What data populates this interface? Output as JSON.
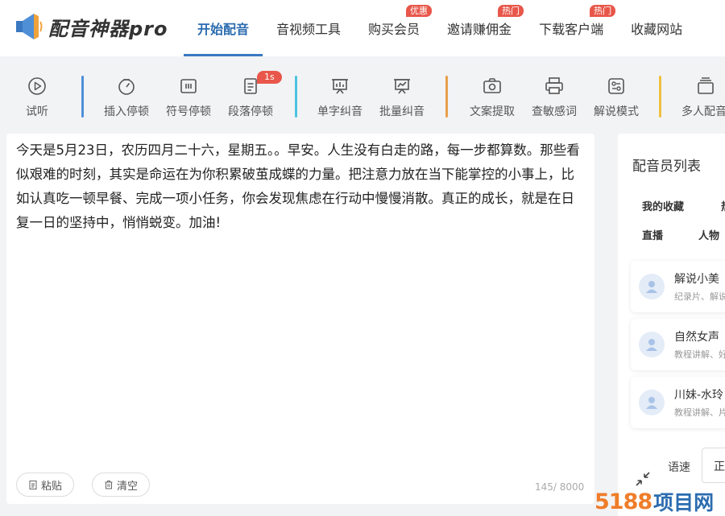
{
  "app": {
    "logo_text": "配音神器pro"
  },
  "nav": [
    {
      "label": "开始配音",
      "active": true
    },
    {
      "label": "音视频工具"
    },
    {
      "label": "购买会员",
      "badge": "优惠"
    },
    {
      "label": "邀请赚佣金",
      "badge": "热门"
    },
    {
      "label": "下载客户端",
      "badge": "热门"
    },
    {
      "label": "收藏网站"
    }
  ],
  "toolbar": {
    "items": [
      {
        "label": "试听",
        "icon": "play-circle-icon"
      },
      {
        "label": "插入停顿",
        "icon": "stopwatch-icon"
      },
      {
        "label": "符号停顿",
        "icon": "symbol-pause-icon"
      },
      {
        "label": "段落停顿",
        "icon": "document-icon",
        "badge": "1s"
      },
      {
        "label": "单字纠音",
        "icon": "presentation-icon"
      },
      {
        "label": "批量纠音",
        "icon": "chart-board-icon"
      },
      {
        "label": "文案提取",
        "icon": "camera-icon"
      },
      {
        "label": "查敏感词",
        "icon": "printer-icon"
      },
      {
        "label": "解说模式",
        "icon": "sliders-icon"
      },
      {
        "label": "多人配音",
        "icon": "layers-icon"
      }
    ]
  },
  "editor": {
    "text": "今天是5月23日，农历四月二十六，星期五。。早安。人生没有白走的路，每一步都算数。那些看似艰难的时刻，其实是命运在为你积累破茧成蝶的力量。把注意力放在当下能掌控的小事上，比如认真吃一顿早餐、完成一项小任务，你会发现焦虑在行动中慢慢消散。真正的成长，就是在日复一日的坚持中，悄悄蜕变。加油!",
    "paste_label": "粘贴",
    "clear_label": "清空",
    "counter": "145/ 8000"
  },
  "panel": {
    "title": "配音员列表",
    "tabs": [
      "我的收藏",
      "热",
      "直播",
      "人物"
    ],
    "voices": [
      {
        "name": "解说小美",
        "desc": "纪录片、解说"
      },
      {
        "name": "自然女声",
        "desc": "教程讲解、好"
      },
      {
        "name": "川妹-水玲",
        "desc": "教程讲解、片"
      }
    ],
    "speed_label": "语速",
    "speed_value": "正"
  },
  "watermark": {
    "num": "5188",
    "text": "项目网"
  },
  "colors": {
    "accent": "#3a78c2",
    "badge": "#e8574a",
    "sep1": "#4f8fd6",
    "sep2": "#4cc3e0",
    "sep3": "#e8a04a",
    "sep4": "#f0c040"
  }
}
